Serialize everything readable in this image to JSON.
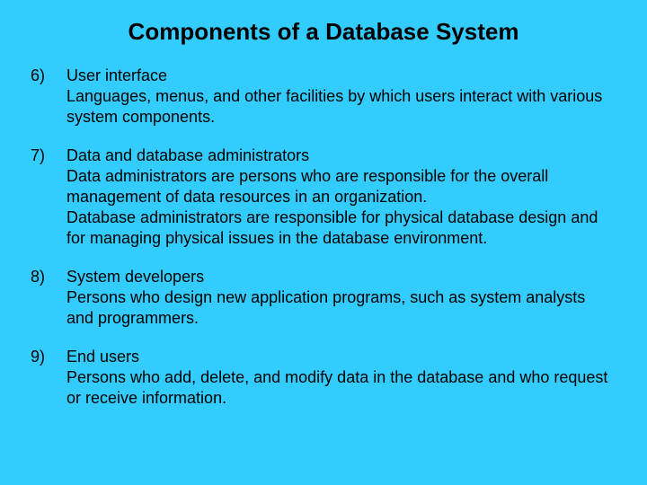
{
  "title": "Components of a Database System",
  "items": [
    {
      "num": "6)",
      "term": "User interface",
      "paras": [
        "Languages, menus, and other facilities by which users interact with various system components."
      ]
    },
    {
      "num": "7)",
      "term": "Data and database administrators",
      "paras": [
        "Data administrators are persons who are responsible for the overall management of data resources in an organization.",
        "Database administrators are responsible for physical database design and for managing physical issues in the database environment."
      ]
    },
    {
      "num": "8)",
      "term": "System developers",
      "paras": [
        "Persons who design new application programs, such as system analysts and programmers."
      ]
    },
    {
      "num": "9)",
      "term": "End users",
      "paras": [
        "Persons who add, delete, and modify data in the database and who request or receive information."
      ]
    }
  ]
}
